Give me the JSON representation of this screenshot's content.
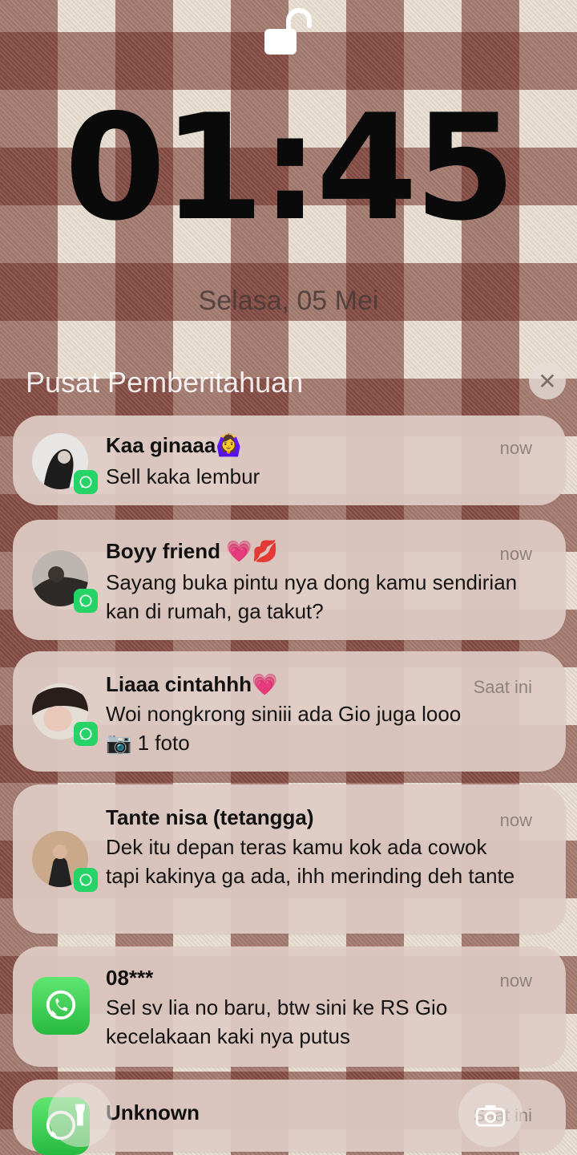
{
  "lockscreen": {
    "time": "01:45",
    "date": "Selasa, 05 Mei",
    "notification_center_title": "Pusat Pemberitahuan",
    "close_label": "✕"
  },
  "notifications": [
    {
      "sender": "Kaa ginaaa🙆‍♀️",
      "time": "now",
      "message": "Sell kaka lembur",
      "app": "WhatsApp"
    },
    {
      "sender": "Boyy friend 💗💋",
      "time": "now",
      "message": "Sayang buka pintu nya dong kamu sendirian kan di rumah, ga takut?",
      "app": "WhatsApp"
    },
    {
      "sender": "Liaaa cintahhh💗",
      "time": "Saat ini",
      "message": "Woi nongkrong siniii ada Gio juga looo",
      "message2": "📷 1 foto",
      "app": "WhatsApp"
    },
    {
      "sender": "Tante nisa (tetangga)",
      "time": "now",
      "message": "Dek itu depan teras kamu kok ada cowok tapi kakinya ga ada, ihh merinding deh tante",
      "app": "WhatsApp"
    },
    {
      "sender": "08***",
      "time": "now",
      "message": "Sel sv lia no baru, btw sini ke RS Gio kecelakaan kaki nya putus",
      "app": "WhatsApp"
    },
    {
      "sender": "Unknown",
      "time": "Saat ini",
      "message": "",
      "app": "WhatsApp"
    }
  ],
  "colors": {
    "whatsapp_green": "#25d366",
    "card_bg": "#decac4",
    "gingham": "#6c2820"
  },
  "icons": [
    "unlock-icon",
    "close-icon",
    "whatsapp-icon",
    "flashlight-icon",
    "camera-icon"
  ]
}
